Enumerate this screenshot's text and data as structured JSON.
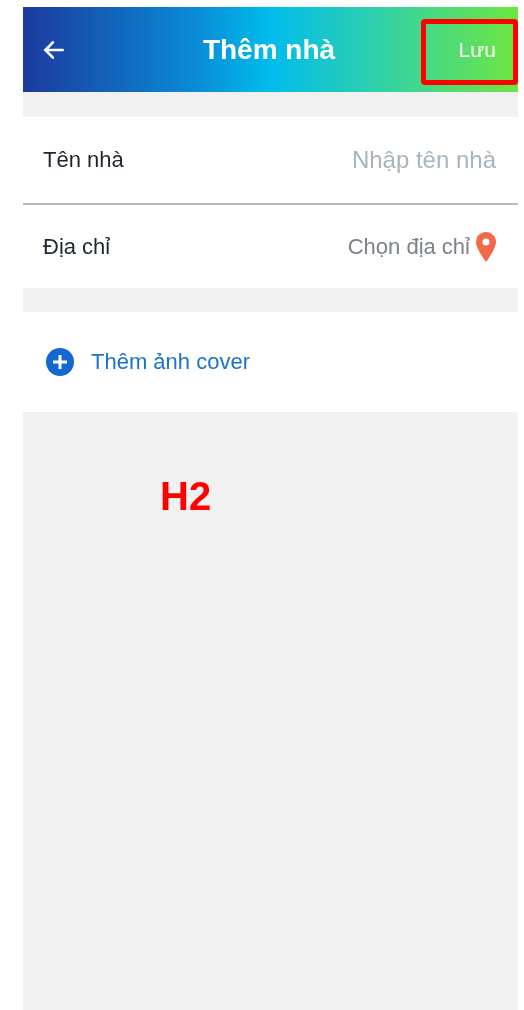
{
  "header": {
    "title": "Thêm nhà",
    "save_button": {
      "label": "Lưu",
      "highlighted": true
    }
  },
  "fields": [
    {
      "kind": "input",
      "label": "Tên nhà",
      "placeholder": "Nhập tên nhà"
    },
    {
      "kind": "picker",
      "label": "Địa chỉ",
      "placeholder": "Chọn địa chỉ"
    }
  ],
  "add_cover": {
    "label": "Thêm ảnh cover"
  },
  "annotation": {
    "label": "H2"
  }
}
